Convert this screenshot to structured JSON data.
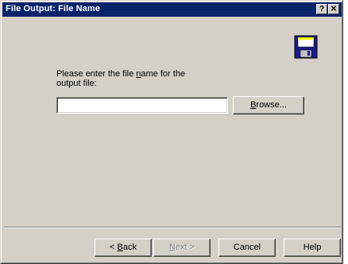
{
  "window": {
    "title": "File Output: File Name",
    "help_glyph": "?",
    "close_glyph": "✕"
  },
  "icon": "floppy-disk-icon",
  "prompt": {
    "line1_before": "Please enter the file ",
    "line1_accel": "n",
    "line1_after": "ame for the",
    "line2": "output file:"
  },
  "filename_input": {
    "value": ""
  },
  "buttons": {
    "browse": {
      "accel": "B",
      "rest": "rowse..."
    },
    "back": {
      "prefix": "< ",
      "accel": "B",
      "rest": "ack"
    },
    "next": {
      "accel": "N",
      "rest": "ext >"
    },
    "cancel": "Cancel",
    "help": "Help"
  },
  "colors": {
    "titlebar": "#0a246a",
    "face": "#d4d0c8"
  }
}
